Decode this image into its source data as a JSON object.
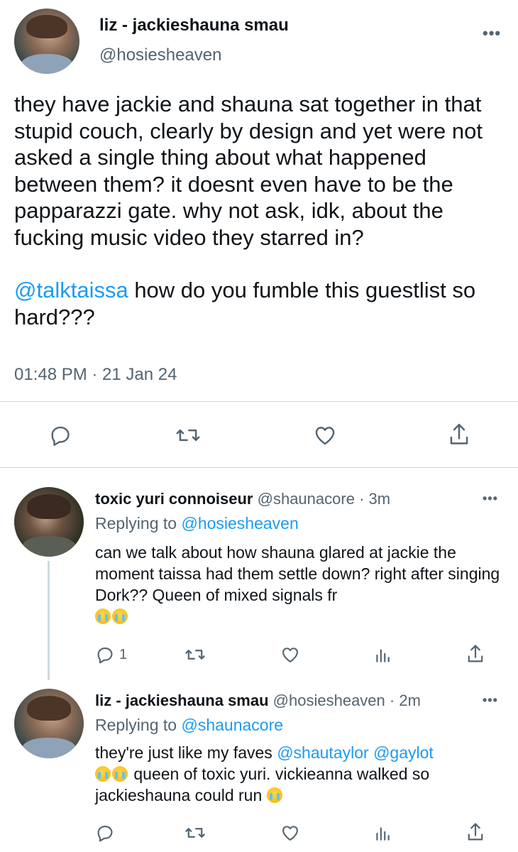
{
  "main_tweet": {
    "display_name": "liz - jackieshauna smau",
    "handle": "@hosiesheaven",
    "more_label": "•••",
    "paragraph1": "they have jackie and shauna sat together in that stupid couch, clearly by design and yet were not asked a single thing about what happened between them? it doesnt even have to be the papparazzi gate. why not ask, idk, about the fucking music video they starred in?",
    "mention": "@talktaissa",
    "paragraph2_rest": " how do you fumble this guestlist so hard???",
    "timestamp": "01:48 PM · 21 Jan 24",
    "actions": [
      "reply-icon",
      "retweet-icon",
      "like-icon",
      "share-icon"
    ]
  },
  "replies": [
    {
      "display_name": "toxic yuri connoiseur",
      "handle": "@shaunacore",
      "time": "· 3m",
      "more_label": "•••",
      "replying_label": "Replying to ",
      "replying_handle": "@hosiesheaven",
      "text": "can we talk about how shauna glared at jackie the moment taissa had them settle down? right after singing Dork?? Queen of mixed signals fr",
      "reply_count": "1",
      "emoji": [
        "loudly-crying-face",
        "loudly-crying-face"
      ]
    },
    {
      "display_name": "liz - jackieshauna smau",
      "handle": "@hosiesheaven",
      "time": "· 2m",
      "more_label": "•••",
      "replying_label": "Replying to ",
      "replying_handle": "@shaunacore",
      "text_part1": "they're just like my faves ",
      "mention1": "@shautaylor",
      "mention2": "@gaylot",
      "text_part2": " queen of toxic yuri. vickieanna walked so jackieshauna could run",
      "emoji": [
        "loudly-crying-face",
        "loudly-crying-face",
        "loudly-crying-face"
      ]
    }
  ],
  "colors": {
    "text": "#0f1419",
    "muted": "#536471",
    "link": "#1d9bf0",
    "divider": "#cfd9de"
  }
}
